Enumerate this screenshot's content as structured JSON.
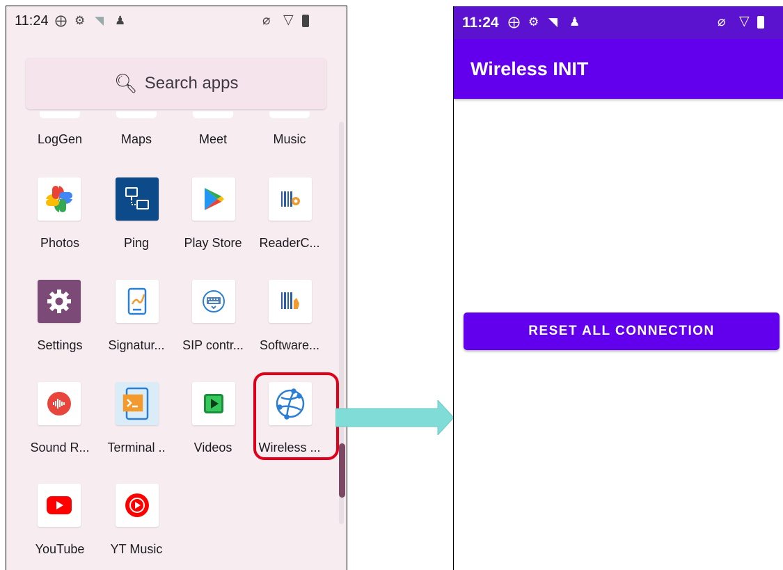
{
  "status_bar": {
    "time": "11:24",
    "icons_left": [
      "sync-icon",
      "gear-icon",
      "wifi-question-icon",
      "people-icon"
    ],
    "icons_right": [
      "alarm-off-icon",
      "signal-icon",
      "battery-icon"
    ]
  },
  "launcher": {
    "search_placeholder": "Search apps",
    "top_row_labels": [
      "LogGen",
      "Maps",
      "Meet",
      "Music"
    ],
    "apps": [
      {
        "label": "Photos",
        "icon": "photos-icon"
      },
      {
        "label": "Ping",
        "icon": "ping-icon"
      },
      {
        "label": "Play Store",
        "icon": "play-store-icon"
      },
      {
        "label": "ReaderC...",
        "icon": "barcode-reader-icon"
      },
      {
        "label": "Settings",
        "icon": "settings-icon"
      },
      {
        "label": "Signatur...",
        "icon": "signature-icon"
      },
      {
        "label": "SIP contr...",
        "icon": "keyboard-icon"
      },
      {
        "label": "Software...",
        "icon": "software-scanner-icon"
      },
      {
        "label": "Sound R...",
        "icon": "sound-recorder-icon"
      },
      {
        "label": "Terminal ..",
        "icon": "terminal-icon"
      },
      {
        "label": "Videos",
        "icon": "videos-icon"
      },
      {
        "label": "Wireless ...",
        "icon": "wireless-init-icon"
      },
      {
        "label": "YouTube",
        "icon": "youtube-icon"
      },
      {
        "label": "YT Music",
        "icon": "yt-music-icon"
      }
    ],
    "highlighted_app": "Wireless ..."
  },
  "wireless_app": {
    "title": "Wireless INIT",
    "reset_button_label": "RESET ALL CONNECTION"
  },
  "colors": {
    "accent": "#6200ee",
    "status_bar_dark": "#5c13d0",
    "highlight": "#e0001a",
    "arrow": "#7fdcd6"
  }
}
